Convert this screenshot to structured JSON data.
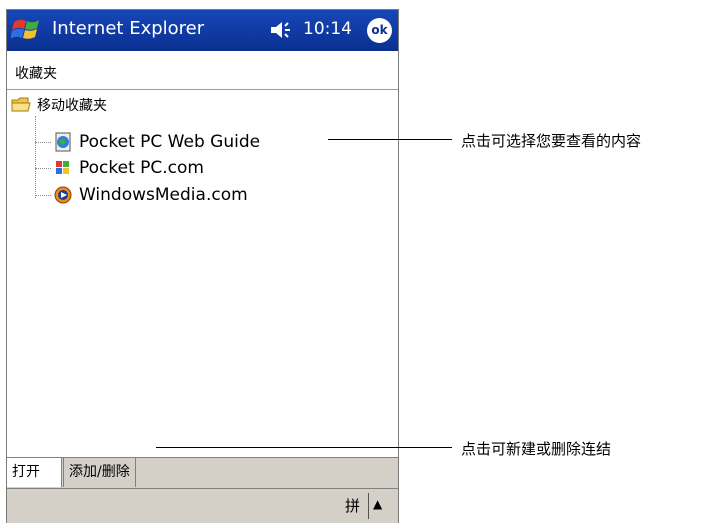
{
  "titlebar": {
    "app_title": "Internet Explorer",
    "time": "10:14",
    "ok_label": "ok",
    "start_icon": "windows-flag-icon",
    "volume_icon": "speaker-icon"
  },
  "breadcrumb": "收藏夹",
  "tree": {
    "root_label": "移动收藏夹",
    "items": [
      {
        "label": "Pocket PC Web Guide",
        "icon": "globe-page-icon"
      },
      {
        "label": "Pocket PC.com",
        "icon": "windows-logo-icon"
      },
      {
        "label": "WindowsMedia.com",
        "icon": "media-player-icon"
      }
    ]
  },
  "tabs": {
    "open": "打开",
    "add_delete": "添加/删除"
  },
  "input_panel": {
    "ime_label": "拼",
    "arrow": "▲"
  },
  "annotations": {
    "select_content": "点击可选择您要查看的内容",
    "create_delete_link": "点击可新建或删除连结"
  },
  "colors": {
    "titlebar": "#0a2f90",
    "toolbar": "#d4d0c8"
  }
}
